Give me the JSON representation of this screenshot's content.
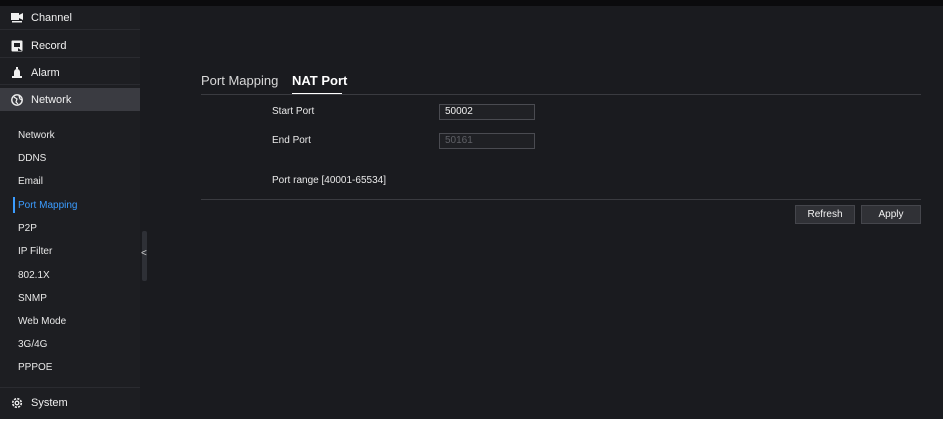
{
  "sidebar": {
    "items": [
      {
        "label": "Channel",
        "icon": "channel-icon"
      },
      {
        "label": "Record",
        "icon": "record-icon"
      },
      {
        "label": "Alarm",
        "icon": "alarm-icon"
      },
      {
        "label": "Network",
        "icon": "network-globe-icon"
      }
    ],
    "network_submenu": [
      {
        "label": "Network"
      },
      {
        "label": "DDNS"
      },
      {
        "label": "Email"
      },
      {
        "label": "Port Mapping",
        "active": true
      },
      {
        "label": "P2P"
      },
      {
        "label": "IP Filter"
      },
      {
        "label": "802.1X"
      },
      {
        "label": "SNMP"
      },
      {
        "label": "Web Mode"
      },
      {
        "label": "3G/4G"
      },
      {
        "label": "PPPOE"
      }
    ],
    "system": {
      "label": "System",
      "icon": "gear-icon"
    },
    "collapse_arrow": "<"
  },
  "tabs": {
    "port_mapping": "Port Mapping",
    "nat_port": "NAT Port",
    "active": "NAT Port"
  },
  "form": {
    "start_port_label": "Start Port",
    "start_port_value": "50002",
    "end_port_label": "End Port",
    "end_port_value": "50161",
    "range_note": "Port range [40001-65534]"
  },
  "buttons": {
    "refresh": "Refresh",
    "apply": "Apply"
  },
  "colors": {
    "accent": "#3b9cff",
    "background": "#1a1b1f",
    "sidebar": "#1d1e22"
  }
}
